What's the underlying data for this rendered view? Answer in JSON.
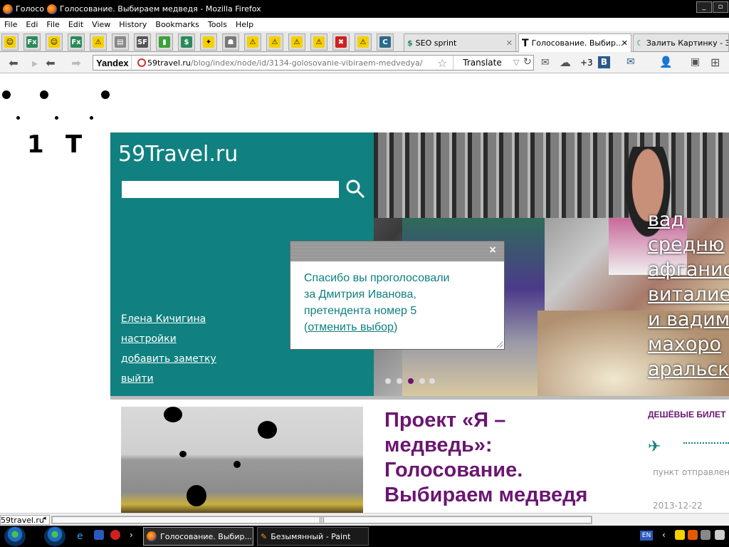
{
  "window": {
    "title_short": "Голосо",
    "title": "Голосование. Выбираем медведя - Mozilla Firefox"
  },
  "menu": [
    "File",
    "Edi",
    "File",
    "Edit",
    "View",
    "History",
    "Bookmarks",
    "Tools",
    "Help"
  ],
  "pinned_tabs": [
    {
      "icon": "smiley-icon",
      "color": "#f5d000",
      "glyph": "☺"
    },
    {
      "icon": "fx-icon",
      "color": "#2a8a5a",
      "glyph": "Fx"
    },
    {
      "icon": "smiley-icon",
      "color": "#f5d000",
      "glyph": "☺"
    },
    {
      "icon": "fx-icon",
      "color": "#2a8a5a",
      "glyph": "Fx"
    },
    {
      "icon": "warning-icon",
      "color": "#f5d000",
      "glyph": "⚠"
    },
    {
      "icon": "document-icon",
      "color": "#888888",
      "glyph": "▤"
    },
    {
      "icon": "sf-icon",
      "color": "#555555",
      "glyph": "SF"
    },
    {
      "icon": "bar-chart-icon",
      "color": "#3aa03a",
      "glyph": "▮"
    },
    {
      "icon": "dollar-icon",
      "color": "#2a8a5a",
      "glyph": "$"
    },
    {
      "icon": "bird-icon",
      "color": "#f5d000",
      "glyph": "✦"
    },
    {
      "icon": "robot-icon",
      "color": "#777777",
      "glyph": "☗"
    },
    {
      "icon": "warning-icon",
      "color": "#f5d000",
      "glyph": "⚠"
    },
    {
      "icon": "warning-icon",
      "color": "#f5d000",
      "glyph": "⚠"
    },
    {
      "icon": "warning-icon",
      "color": "#f5d000",
      "glyph": "⚠"
    },
    {
      "icon": "warning-icon",
      "color": "#f5d000",
      "glyph": "⚠"
    },
    {
      "icon": "blocked-icon",
      "color": "#d02020",
      "glyph": "✖"
    },
    {
      "icon": "warning-icon",
      "color": "#f5d000",
      "glyph": "⚠"
    },
    {
      "icon": "chrome-c-icon",
      "color": "#2a6a8a",
      "glyph": "C"
    }
  ],
  "tabs": [
    {
      "icon": "dollar-icon",
      "label": "SEO sprint",
      "active": false
    },
    {
      "icon": "t-logo-icon",
      "label": "Голосование. Выбир...",
      "active": true
    },
    {
      "icon": "moon-icon",
      "label": "Залить Картинку - З...",
      "active": false
    }
  ],
  "nav": {
    "search_engine": "Yandex",
    "url_host": "59travel.ru",
    "url_path": "/blog/index/node/id/3134-golosovanie-vibiraem-medvedya/",
    "translate": "Translate",
    "plus_count": "+3"
  },
  "site": {
    "name": "59Travel.ru",
    "search_placeholder": "",
    "user_links": [
      "Елена Кичигина",
      "настройки",
      "добавить заметку",
      "выйти"
    ],
    "slide_caption_lines": [
      "вад",
      "средню",
      "афганис",
      "виталие",
      "и вадим",
      "махоро",
      "аральск"
    ],
    "headline": "Проект «Я – медведь»: Голосование. Выбираем медведя",
    "cheap_tickets": "ДЕШЁВЫЕ БИЛЕТ",
    "from_label": "пункт отправлен",
    "date": "2013-12-22"
  },
  "popup": {
    "message_line1": "Спасибо вы проголосовали",
    "message_line2": "за Дмитрия Иванова,",
    "message_line3": "претендента номер 5",
    "cancel_prefix": "(",
    "cancel_link": "отменить выбор",
    "cancel_suffix": ")",
    "close": "×"
  },
  "statusbar": {
    "text": "59travel.ru"
  },
  "taskbar": {
    "items": [
      {
        "label": "Голосование. Выбир...",
        "icon": "firefox-icon"
      },
      {
        "label": "Безымянный - Paint",
        "icon": "paint-icon"
      }
    ],
    "lang": "EN"
  },
  "colors": {
    "teal": "#108080",
    "purple": "#6a1670"
  }
}
